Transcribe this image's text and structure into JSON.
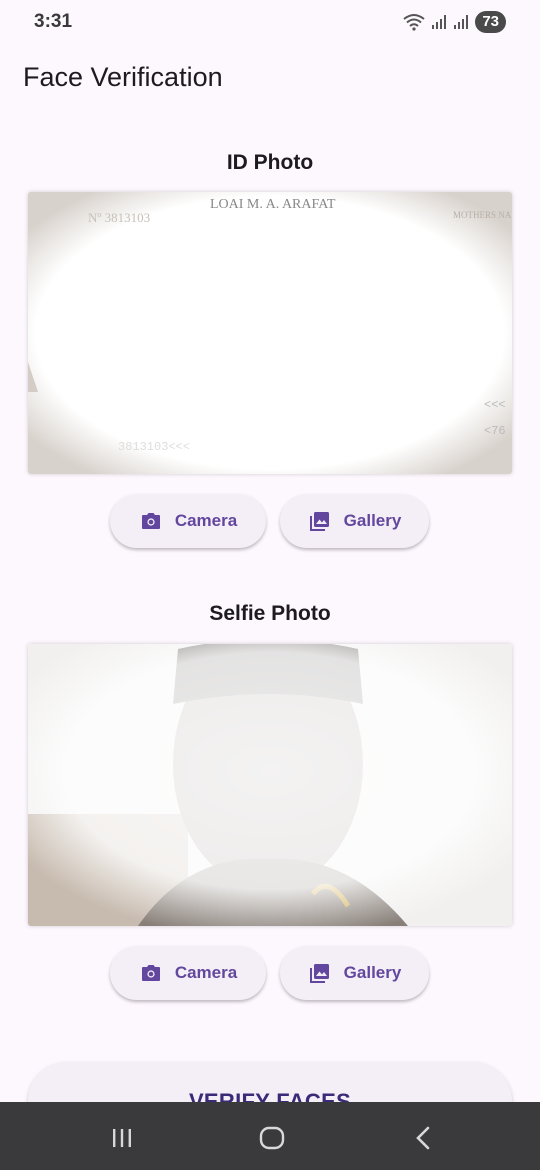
{
  "status_bar": {
    "time": "3:31",
    "battery": "73"
  },
  "app_bar": {
    "title": "Face Verification"
  },
  "id_section": {
    "title": "ID Photo",
    "camera_label": "Camera",
    "gallery_label": "Gallery"
  },
  "selfie_section": {
    "title": "Selfie Photo",
    "camera_label": "Camera",
    "gallery_label": "Gallery"
  },
  "verify_button": {
    "label": "VERIFY FACES"
  },
  "icons": [
    "wifi-icon",
    "signal-icon",
    "camera-icon",
    "gallery-icon",
    "recents-icon",
    "home-icon",
    "back-icon"
  ],
  "colors": {
    "accent": "#63479e",
    "background": "#fdf7fe",
    "button_bg": "#f4eff6",
    "nav_bar": "#3a3a3c"
  }
}
